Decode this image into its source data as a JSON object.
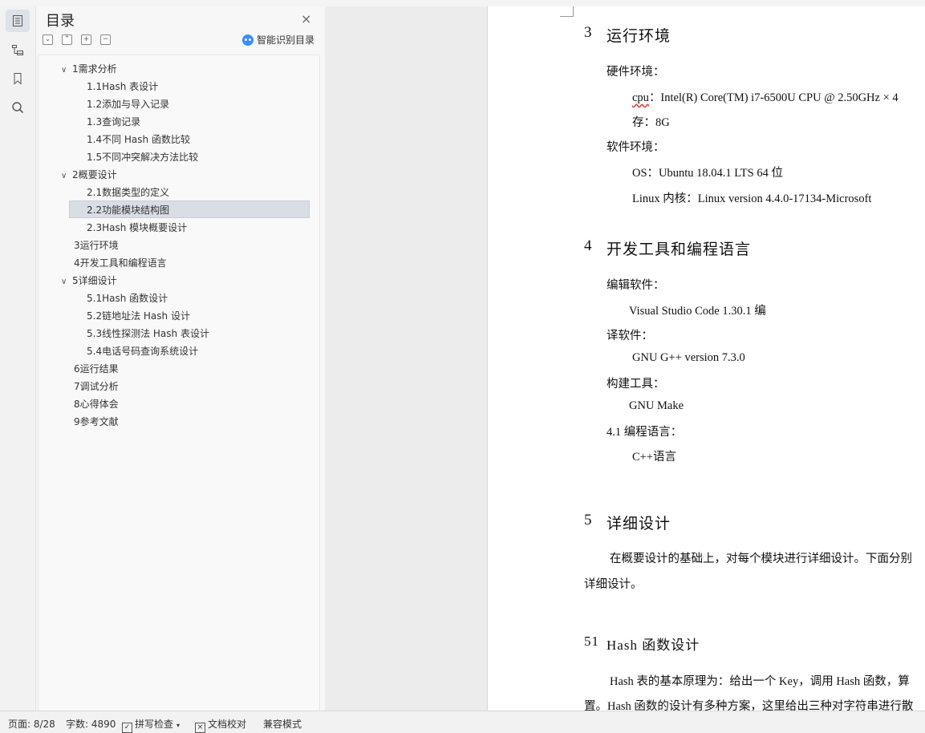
{
  "toc": {
    "title": "目录",
    "close_icon": "×",
    "tools": [
      "⌄",
      "⌃",
      "+",
      "−"
    ],
    "ai_button": "智能识别目录",
    "items": [
      {
        "label": "1需求分析",
        "level": 1,
        "expanded": true
      },
      {
        "label": "1.1Hash 表设计",
        "level": 2
      },
      {
        "label": "1.2添加与导入记录",
        "level": 2
      },
      {
        "label": "1.3查询记录",
        "level": 2
      },
      {
        "label": "1.4不同 Hash 函数比较",
        "level": 2
      },
      {
        "label": "1.5不同冲突解决方法比较",
        "level": 2
      },
      {
        "label": "2概要设计",
        "level": 1,
        "expanded": true
      },
      {
        "label": "2.1数据类型的定义",
        "level": 2
      },
      {
        "label": "2.2功能模块结构图",
        "level": 2,
        "selected": true
      },
      {
        "label": "2.3Hash 模块概要设计",
        "level": 2
      },
      {
        "label": "3运行环境",
        "level": 1
      },
      {
        "label": "4开发工具和编程语言",
        "level": 1
      },
      {
        "label": "5详细设计",
        "level": 1,
        "expanded": true
      },
      {
        "label": "5.1Hash 函数设计",
        "level": 2
      },
      {
        "label": "5.2链地址法 Hash 设计",
        "level": 2
      },
      {
        "label": "5.3线性探测法 Hash 表设计",
        "level": 2
      },
      {
        "label": "5.4电话号码查询系统设计",
        "level": 2
      },
      {
        "label": "6运行结果",
        "level": 1
      },
      {
        "label": "7调试分析",
        "level": 1
      },
      {
        "label": "8心得体会",
        "level": 1
      },
      {
        "label": "9参考文献",
        "level": 1
      }
    ]
  },
  "doc": {
    "s3_num": "3",
    "s3_title": "运行环境",
    "hw_label": "硬件环境：",
    "cpu_word": "cpu",
    "cpu_rest": "：Intel(R) Core(TM) i7-6500U CPU @ 2.50GHz × 4",
    "mem": "存：8G",
    "sw_label": "软件环境：",
    "os": "OS：Ubuntu 18.04.1 LTS 64 位",
    "kernel": "Linux 内核：Linux version 4.4.0-17134-Microsoft",
    "s4_num": "4",
    "s4_title": "开发工具和编程语言",
    "editor_label": "编辑软件：",
    "editor": "Visual Studio Code 1.30.1 编",
    "compiler_label": "译软件：",
    "compiler": "GNU G++ version 7.3.0",
    "build_label": "构建工具：",
    "build": "GNU Make",
    "lang_label": "4.1 编程语言：",
    "lang": "C++语言",
    "s5_num": "5",
    "s5_title": "详细设计",
    "s5_p1": "在概要设计的基础上，对每个模块进行详细设计。下面分别",
    "s5_p2": "详细设计。",
    "s51_num": "51",
    "s51_title": "Hash 函数设计",
    "s51_p1": "Hash 表的基本原理为：给出一个 Key，调用 Hash 函数，算",
    "s51_p2": "置。Hash 函数的设计有多种方案，这里给出三种对字符串进行散"
  },
  "status": {
    "page": "页面: 8/28",
    "words": "字数: 4890",
    "spell": "拼写检查",
    "proof": "文档校对",
    "compat": "兼容模式"
  },
  "icons": {
    "rail": [
      "toc-icon",
      "outline-icon",
      "bookmark-icon",
      "search-icon"
    ]
  }
}
